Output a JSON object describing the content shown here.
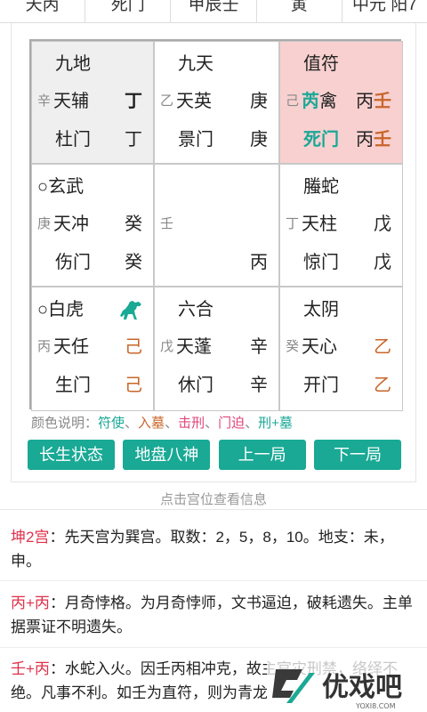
{
  "top_strip": [
    "天丙",
    "死门",
    "甲辰壬",
    "寅",
    "中元 阳7"
  ],
  "palaces": [
    {
      "id": "xun",
      "god": "九地",
      "god_mark": "",
      "small": "辛",
      "star": "天辅",
      "star_right": "丁",
      "door": "杜门",
      "door_right": "丁"
    },
    {
      "id": "li",
      "god": "九天",
      "god_mark": "",
      "small": "乙",
      "star": "天英",
      "star_right": "庚",
      "door": "景门",
      "door_right": "庚"
    },
    {
      "id": "kun",
      "god": "值符",
      "god_mark": "",
      "small": "己",
      "star_a": "芮",
      "star_b": "禽",
      "star_right_a": "丙",
      "star_right_b": "壬",
      "door": "死门",
      "door_right_a": "丙",
      "door_right_b": "壬"
    },
    {
      "id": "zhen",
      "god": "○玄武",
      "small": "庚",
      "star": "天冲",
      "star_right": "癸",
      "door": "伤门",
      "door_right": "癸"
    },
    {
      "id": "center",
      "small": "壬",
      "bottom_right": "丙"
    },
    {
      "id": "dui",
      "god": "螣蛇",
      "small": "丁",
      "star": "天柱",
      "star_right": "戊",
      "door": "惊门",
      "door_right": "戊"
    },
    {
      "id": "gen",
      "god": "○白虎",
      "small": "丙",
      "star": "天任",
      "star_right": "己",
      "door": "生门",
      "door_right": "己"
    },
    {
      "id": "kan",
      "god": "六合",
      "small": "戊",
      "star": "天蓬",
      "star_right": "辛",
      "door": "休门",
      "door_right": "辛"
    },
    {
      "id": "qian",
      "god": "太阴",
      "small": "癸",
      "star": "天心",
      "star_right": "乙",
      "door": "开门",
      "door_right": "乙"
    }
  ],
  "legend": {
    "prefix": "颜色说明：",
    "items": [
      "符使",
      "入墓",
      "击刑",
      "门迫",
      "刑+墓"
    ]
  },
  "buttons": [
    "长生状态",
    "地盘八神",
    "上一局",
    "下一局"
  ],
  "hint": "点击宫位查看信息",
  "descriptions": [
    {
      "key": "坤2宫",
      "text": "：先天宫为巽宫。取数：2，5，8，10。地支：未，申。"
    },
    {
      "key": "丙+丙",
      "text": "：月奇悖格。为月奇悖师，文书逼迫，破耗遗失。主单据票证不明遗失。"
    },
    {
      "key": "壬+丙",
      "text": "：水蛇入火。因壬丙相冲克，故主官灾刑禁，络绎不绝。凡事不利。如壬为直符，则为青龙"
    }
  ],
  "watermark": {
    "text": "优戏吧",
    "sub": "YOXI8.COM"
  },
  "colors": {
    "teal": "#19a995",
    "orange": "#c8662a",
    "red": "#e0304a",
    "pink_bg": "#f8d0d0",
    "gray_bg": "#efefef"
  }
}
